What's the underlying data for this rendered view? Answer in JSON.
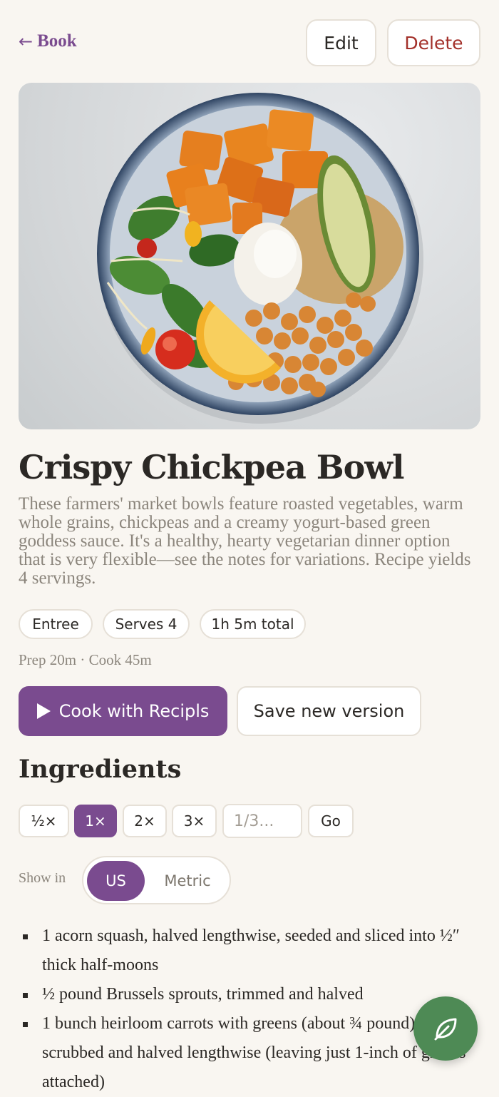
{
  "header": {
    "back_arrow": "←",
    "back_label": "Book",
    "edit_label": "Edit",
    "delete_label": "Delete"
  },
  "recipe": {
    "title": "Crispy Chickpea Bowl",
    "description": "These farmers' market bowls feature roasted vegetables, warm whole grains, chickpeas and a creamy yogurt-based green goddess sauce. It's a healthy, hearty vegetarian dinner option that is very flexible—see the notes for variations. Recipe yields 4 servings.",
    "tags": [
      "Entree",
      "Serves 4",
      "1h 5m total"
    ],
    "times": "Prep 20m · Cook 45m"
  },
  "actions": {
    "cook_label": "Cook with Recipls",
    "save_label": "Save new version"
  },
  "ingredients": {
    "heading": "Ingredients",
    "scale_options": [
      "½×",
      "1×",
      "2×",
      "3×"
    ],
    "selected_scale": "1×",
    "custom_scale_placeholder": "1/3...",
    "go_label": "Go",
    "show_in_label": "Show in",
    "units": [
      "US",
      "Metric"
    ],
    "selected_unit": "US",
    "items": [
      "1 acorn squash, halved lengthwise, seeded and sliced into ½″ thick half-moons",
      "½ pound Brussels sprouts, trimmed and halved",
      "1 bunch heirloom carrots with greens (about ¾ pound), scrubbed and halved lengthwise (leaving just 1-inch of greens attached)"
    ]
  },
  "icons": {
    "play": "play-icon",
    "fab": "leaf-icon"
  },
  "colors": {
    "accent": "#7a4b8f",
    "danger": "#a3302a",
    "fab": "#4e8a55",
    "background": "#f9f6f1"
  }
}
